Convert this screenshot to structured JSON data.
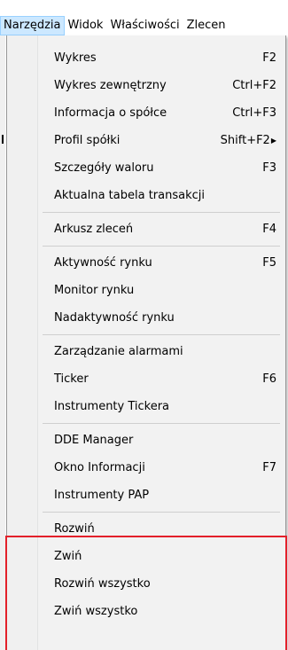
{
  "menubar": {
    "items": [
      {
        "label": "Narzędzia",
        "active": true
      },
      {
        "label": "Widok"
      },
      {
        "label": "Właściwości"
      },
      {
        "label": "Zlecen"
      }
    ]
  },
  "menu": {
    "groups": [
      [
        {
          "label": "Wykres",
          "shortcut": "F2"
        },
        {
          "label": "Wykres zewnętrzny",
          "shortcut": "Ctrl+F2"
        },
        {
          "label": "Informacja o spółce",
          "shortcut": "Ctrl+F3"
        },
        {
          "label": "Profil spółki",
          "shortcut": "Shift+F2",
          "submenu": true
        },
        {
          "label": "Szczegóły waloru",
          "shortcut": "F3"
        },
        {
          "label": "Aktualna tabela transakcji",
          "shortcut": ""
        }
      ],
      [
        {
          "label": "Arkusz zleceń",
          "shortcut": "F4"
        }
      ],
      [
        {
          "label": "Aktywność rynku",
          "shortcut": "F5"
        },
        {
          "label": "Monitor rynku",
          "shortcut": ""
        },
        {
          "label": "Nadaktywność rynku",
          "shortcut": ""
        }
      ],
      [
        {
          "label": "Zarządzanie alarmami",
          "shortcut": ""
        },
        {
          "label": "Ticker",
          "shortcut": "F6"
        },
        {
          "label": "Instrumenty Tickera",
          "shortcut": ""
        }
      ],
      [
        {
          "label": "DDE Manager",
          "shortcut": ""
        },
        {
          "label": "Okno Informacji",
          "shortcut": "F7"
        },
        {
          "label": "Instrumenty PAP",
          "shortcut": ""
        }
      ],
      [
        {
          "label": "Rozwiń",
          "shortcut": ""
        },
        {
          "label": "Zwiń",
          "shortcut": ""
        },
        {
          "label": "Rozwiń wszystko",
          "shortcut": ""
        },
        {
          "label": "Zwiń wszystko",
          "shortcut": ""
        }
      ]
    ]
  },
  "colors": {
    "highlight_box": "#e3202a",
    "active_menu_bg": "#cce8ff"
  },
  "icons": {
    "submenu": "submenu-arrow-icon"
  }
}
